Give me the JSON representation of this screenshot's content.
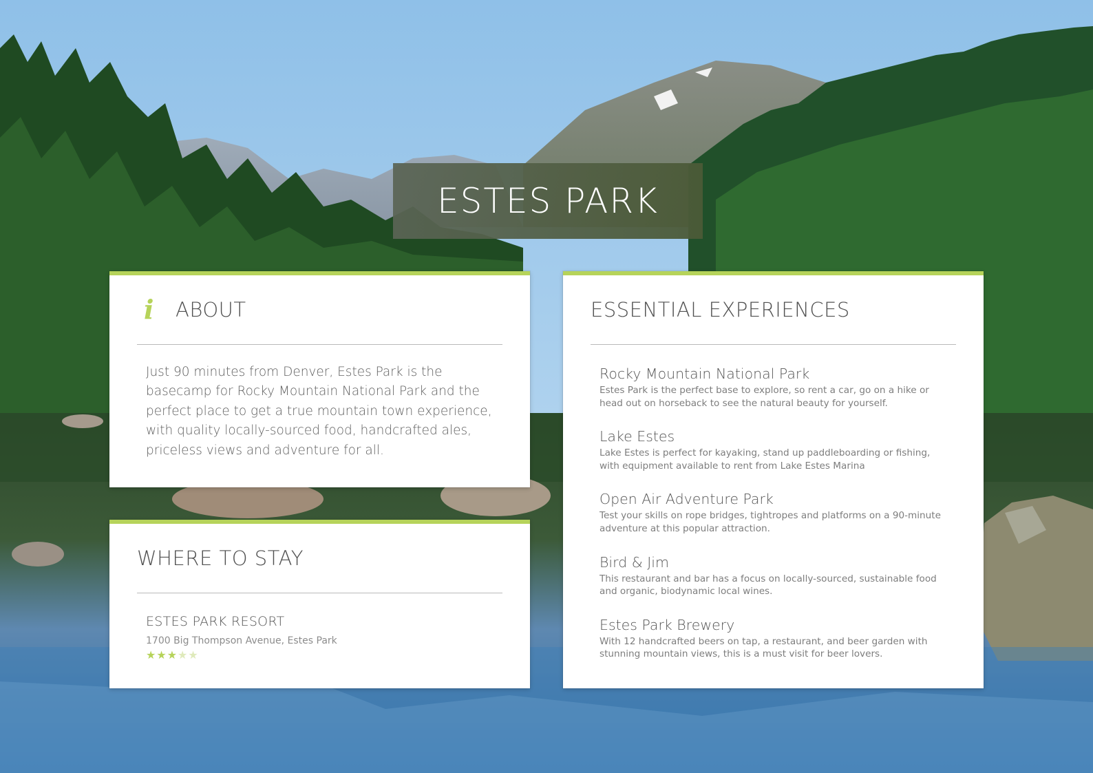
{
  "page_title": "ESTES PARK",
  "colors": {
    "accent": "#b6d35a",
    "star_empty": "#dfeabb",
    "title_bg": "#4f5b46"
  },
  "about": {
    "heading": "ABOUT",
    "icon": "info-icon",
    "body": "Just 90 minutes from Denver, Estes Park is the basecamp for Rocky Mountain National Park and the perfect place to get a true mountain town experience, with quality locally-sourced food, handcrafted ales, priceless views and adventure for all."
  },
  "stay": {
    "heading": "WHERE TO STAY",
    "hotel_name": "ESTES PARK RESORT",
    "hotel_address": "1700 Big Thompson Avenue, Estes Park",
    "rating": 3,
    "rating_max": 5
  },
  "experiences": {
    "heading": "ESSENTIAL EXPERIENCES",
    "items": [
      {
        "name": "Rocky Mountain National Park",
        "desc": "Estes Park is the perfect base to explore, so rent a car, go on a hike or head out on horseback to see the natural beauty for yourself."
      },
      {
        "name": "Lake Estes",
        "desc": "Lake Estes is perfect for kayaking, stand up paddleboarding or fishing, with equipment available to rent from Lake Estes Marina"
      },
      {
        "name": "Open Air Adventure Park",
        "desc": "Test your skills on rope bridges, tightropes and platforms on a 90-minute adventure at this popular attraction."
      },
      {
        "name": "Bird & Jim",
        "desc": "This restaurant and bar has a focus on locally-sourced, sustainable food and organic, biodynamic local wines."
      },
      {
        "name": "Estes Park Brewery",
        "desc": "With 12 handcrafted beers on tap, a restaurant, and beer garden with stunning mountain views, this is a must visit for beer lovers."
      }
    ]
  }
}
